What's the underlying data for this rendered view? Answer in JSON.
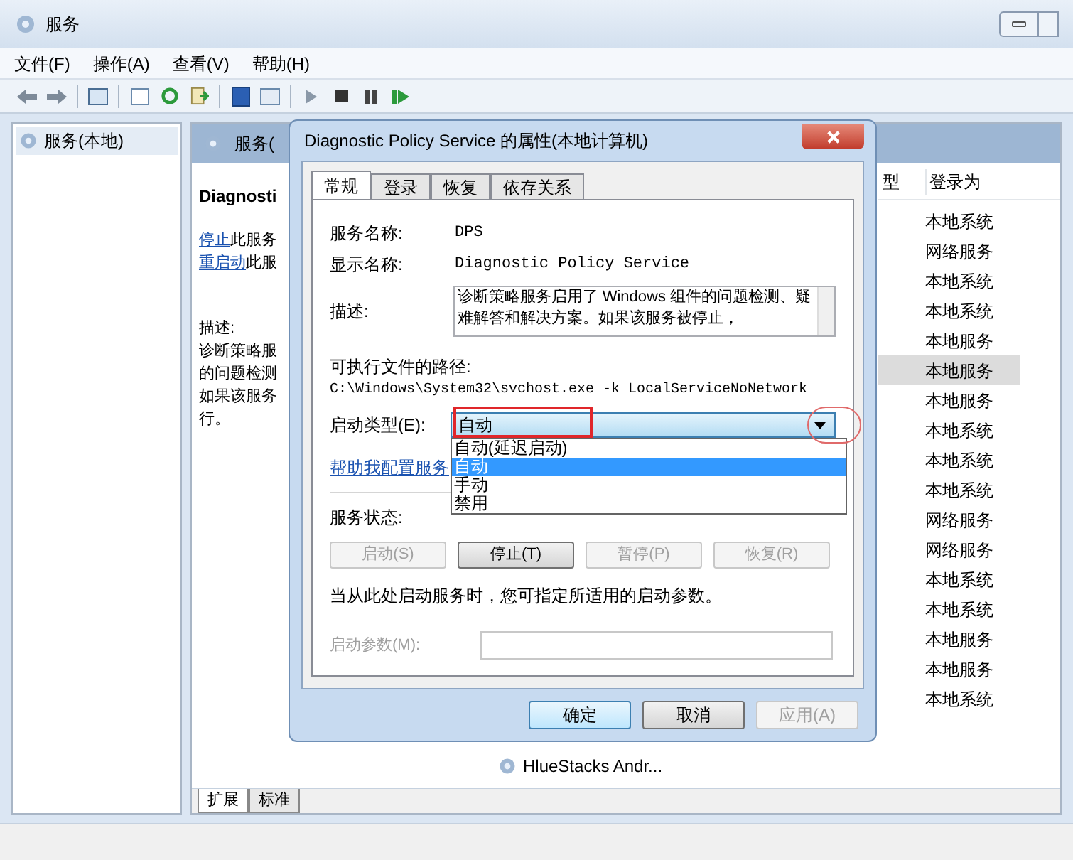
{
  "window": {
    "title": "服务"
  },
  "menu": [
    "文件(F)",
    "操作(A)",
    "查看(V)",
    "帮助(H)"
  ],
  "tree": {
    "items": [
      {
        "label": "服务(本地)",
        "selected": true
      }
    ]
  },
  "main_pane": {
    "header": "服务(",
    "service_title": "Diagnosti",
    "actions": [
      {
        "link": "停止",
        "rest": "此服务"
      },
      {
        "link": "重启动",
        "rest": "此服"
      }
    ],
    "description_label": "描述:",
    "description_lines": [
      "诊断策略服",
      "的问题检测",
      "如果该服务",
      "行。"
    ],
    "columns": [
      "型",
      "登录为"
    ],
    "rows": [
      {
        "logon": "本地系统",
        "selected": false
      },
      {
        "logon": "网络服务",
        "selected": false
      },
      {
        "logon": "本地系统",
        "selected": false
      },
      {
        "logon": "本地系统",
        "selected": false
      },
      {
        "logon": "本地服务",
        "selected": false
      },
      {
        "logon": "本地服务",
        "selected": true
      },
      {
        "logon": "本地服务",
        "selected": false
      },
      {
        "logon": "本地系统",
        "selected": false
      },
      {
        "logon": "本地系统",
        "selected": false
      },
      {
        "logon": "本地系统",
        "selected": false
      },
      {
        "logon": "网络服务",
        "selected": false
      },
      {
        "logon": "网络服务",
        "selected": false
      },
      {
        "logon": "本地系统",
        "selected": false
      },
      {
        "logon": "本地系统",
        "selected": false
      },
      {
        "logon": "本地服务",
        "selected": false
      },
      {
        "logon": "本地服务",
        "selected": false
      },
      {
        "logon": "本地系统",
        "selected": false
      }
    ],
    "bottom_service": "HlueStacks Andr...",
    "view_tabs": [
      {
        "label": "扩展",
        "selected": true
      },
      {
        "label": "标准",
        "selected": false
      }
    ]
  },
  "dialog": {
    "title": "Diagnostic Policy Service 的属性(本地计算机)",
    "tabs": [
      {
        "label": "常规",
        "selected": true
      },
      {
        "label": "登录",
        "selected": false
      },
      {
        "label": "恢复",
        "selected": false
      },
      {
        "label": "依存关系",
        "selected": false
      }
    ],
    "service_name_label": "服务名称:",
    "service_name": "DPS",
    "display_name_label": "显示名称:",
    "display_name": "Diagnostic Policy Service",
    "description_label": "描述:",
    "description": "诊断策略服务启用了 Windows 组件的问题检测、疑难解答和解决方案。如果该服务被停止，",
    "path_label": "可执行文件的路径:",
    "path": "C:\\Windows\\System32\\svchost.exe -k LocalServiceNoNetwork",
    "startup_label": "启动类型(E):",
    "startup_value": "自动",
    "startup_options": [
      {
        "label": "自动(延迟启动)",
        "selected": false
      },
      {
        "label": "自动",
        "selected": true
      },
      {
        "label": "手动",
        "selected": false
      },
      {
        "label": "禁用",
        "selected": false
      }
    ],
    "help_link": "帮助我配置服务",
    "status_label": "服务状态:",
    "control_buttons": [
      {
        "label": "启动(S)",
        "disabled": true
      },
      {
        "label": "停止(T)",
        "disabled": false
      },
      {
        "label": "暂停(P)",
        "disabled": true
      },
      {
        "label": "恢复(R)",
        "disabled": true
      }
    ],
    "hint": "当从此处启动服务时，您可指定所适用的启动参数。",
    "params_label": "启动参数(M):",
    "buttons": [
      {
        "label": "确定",
        "default": true,
        "disabled": false
      },
      {
        "label": "取消",
        "default": false,
        "disabled": false
      },
      {
        "label": "应用(A)",
        "default": false,
        "disabled": true
      }
    ]
  }
}
